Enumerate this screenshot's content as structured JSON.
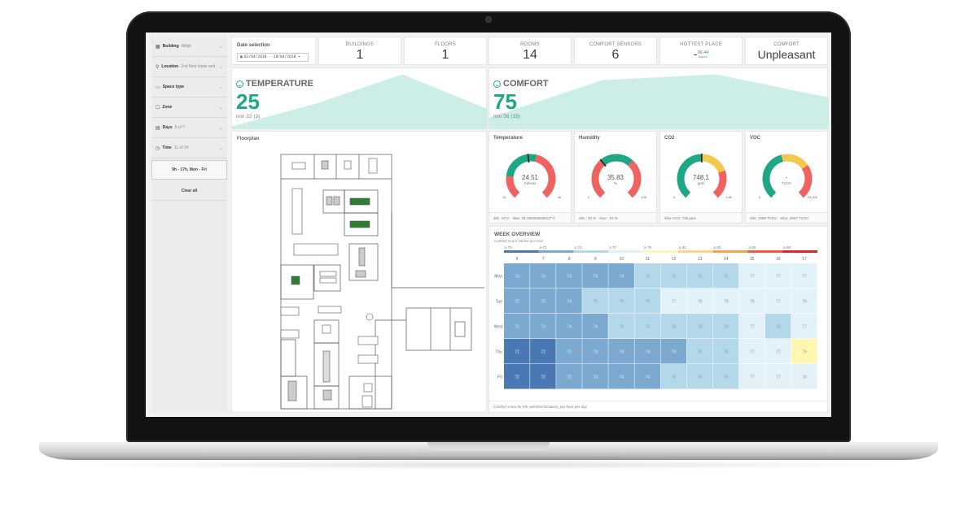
{
  "sidebar": {
    "filters": [
      {
        "icon": "building-icon",
        "glyph": "▦",
        "label": "Building",
        "value": "Winjk"
      },
      {
        "icon": "location-pin-icon",
        "glyph": "⚲",
        "label": "Location",
        "value": "2nd floor kiosk and ..."
      },
      {
        "icon": "monitor-icon",
        "glyph": "▭",
        "label": "Space type",
        "value": ""
      },
      {
        "icon": "square-icon",
        "glyph": "☐",
        "label": "Zone",
        "value": ""
      },
      {
        "icon": "calendar-icon",
        "glyph": "▤",
        "label": "Days",
        "value": "5 of 7"
      },
      {
        "icon": "clock-icon",
        "glyph": "◷",
        "label": "Time",
        "value": "11 of 24"
      }
    ],
    "preset_label": "9h - 17h, Mon - Fri",
    "clear_label": "Clear all"
  },
  "date_selection": {
    "title": "Date selection",
    "range": "03/04/2018 - 28/04/2018 ▾"
  },
  "kpis": [
    {
      "label": "BUILDINGS",
      "value": "1"
    },
    {
      "label": "FLOORS",
      "value": "1"
    },
    {
      "label": "ROOMS",
      "value": "14"
    },
    {
      "label": "COMFORT SENSORS",
      "value": "6"
    }
  ],
  "hottest": {
    "label": "HOTTEST PLACE",
    "dash": "-",
    "value": "36.44",
    "sub": "highest"
  },
  "comfort_kpi": {
    "label": "COMFORT",
    "value": "Unpleasant"
  },
  "temperature": {
    "title": "TEMPERATURE",
    "value": "25",
    "min_prefix": "min 22 (",
    "min_count": "3",
    "min_suffix": ")",
    "trend": [
      0.05,
      0.45,
      0.95,
      0.35
    ]
  },
  "comfort": {
    "title": "COMFORT",
    "value": "75",
    "min_prefix": "min 56 (",
    "min_count": "19",
    "min_suffix": ")",
    "trend": [
      0.2,
      0.85,
      0.95,
      0.55
    ]
  },
  "floorplan": {
    "title": "Floorplan"
  },
  "colors": {
    "teal": "#1ea784",
    "red": "#f0625d",
    "yellow": "#f2c94c",
    "trend_fill": "#cdeee6"
  },
  "gauges": [
    {
      "title": "Temperature",
      "value": "24.51",
      "unit": "Celsius",
      "min": "15",
      "max": "35",
      "needle": 0.476,
      "bands": [
        [
          0,
          0.2,
          "red"
        ],
        [
          0.2,
          0.55,
          "teal"
        ],
        [
          0.55,
          1,
          "red"
        ]
      ],
      "footer": "Min :19°C - Max :31.558464638127°C"
    },
    {
      "title": "Humidity",
      "value": "35.83",
      "unit": "%",
      "min": "0",
      "max": "100",
      "needle": 0.358,
      "bands": [
        [
          0,
          0.35,
          "red"
        ],
        [
          0.35,
          0.65,
          "teal"
        ],
        [
          0.65,
          1,
          "red"
        ]
      ],
      "footer": "Min : 52 % - Max : 53 %"
    },
    {
      "title": "CO2",
      "value": "748.1",
      "unit": "ppm",
      "min": "0",
      "max": "1.5k",
      "needle": 0.499,
      "bands": [
        [
          0,
          0.5,
          "teal"
        ],
        [
          0.5,
          0.75,
          "yellow"
        ],
        [
          0.75,
          1,
          "red"
        ]
      ],
      "footer": "Max CO2: 748 ppm"
    },
    {
      "title": "VOC",
      "value": "-",
      "unit": "TVOC",
      "min": "0",
      "max": "15,000",
      "needle": null,
      "bands": [
        [
          0,
          0.45,
          "teal"
        ],
        [
          0.45,
          0.7,
          "yellow"
        ],
        [
          0.7,
          1,
          "red"
        ]
      ],
      "footer": "Min: 1568 TVOC - Max: 4567 TVOC"
    }
  ],
  "week": {
    "title": "WEEK OVERVIEW",
    "subtitle": "Comfort score values per hour",
    "footer": "Comfort score for the selected locations, per hour per day."
  },
  "chart_data": {
    "type": "heatmap",
    "title": "WEEK OVERVIEW",
    "subtitle": "Comfort score values per hour",
    "x": [
      "6",
      "7",
      "8",
      "9",
      "10",
      "11",
      "12",
      "13",
      "14",
      "15",
      "16",
      "17"
    ],
    "y": [
      "Mon",
      "Tue",
      "Wed",
      "Thu",
      "Fri"
    ],
    "values": [
      [
        73,
        73,
        73,
        74,
        74,
        76,
        76,
        76,
        76,
        77,
        77,
        77
      ],
      [
        72,
        73,
        74,
        75,
        76,
        76,
        77,
        78,
        78,
        78,
        77,
        78
      ],
      [
        73,
        73,
        74,
        74,
        75,
        75,
        76,
        76,
        76,
        77,
        76,
        77
      ],
      [
        72,
        72,
        72,
        73,
        74,
        74,
        74,
        76,
        76,
        77,
        77,
        79
      ],
      [
        72,
        72,
        72,
        73,
        74,
        74,
        76,
        76,
        76,
        77,
        77,
        78
      ]
    ],
    "legend": [
      {
        "label": "≥ 70",
        "color": "#4a78b5"
      },
      {
        "label": "≥ 72",
        "color": "#7ba9d0"
      },
      {
        "label": "≥ 74",
        "color": "#b3d8ea"
      },
      {
        "label": "≥ 77",
        "color": "#e3f2f9"
      },
      {
        "label": "≥ 79",
        "color": "#fff6b0"
      },
      {
        "label": "≥ 81",
        "color": "#fcd48a"
      },
      {
        "label": "≥ 83",
        "color": "#f5a44f"
      },
      {
        "label": "≥ 86",
        "color": "#ee5a45"
      },
      {
        "label": "≥ 88",
        "color": "#d42a2a"
      }
    ],
    "legend_placement": "top"
  }
}
